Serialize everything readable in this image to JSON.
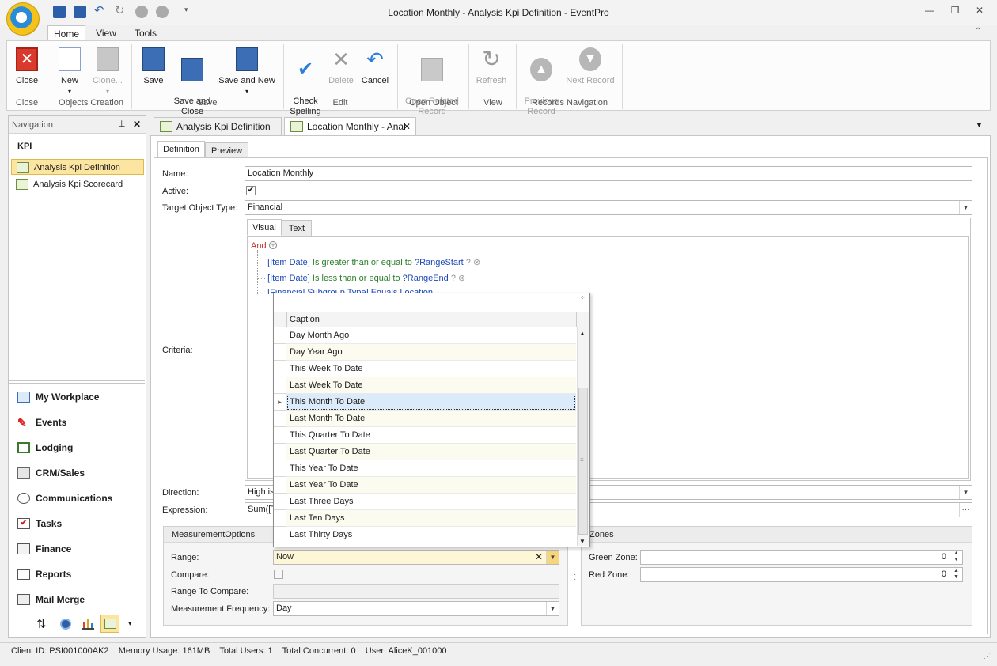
{
  "window": {
    "title": "Location Monthly - Analysis Kpi Definition - EventPro",
    "controls": [
      "minimize",
      "restore",
      "close"
    ]
  },
  "menu_tabs": [
    "Home",
    "View",
    "Tools"
  ],
  "ribbon": {
    "buttons": {
      "close": "Close",
      "new": "New",
      "clone": "Clone...",
      "save": "Save",
      "save_and_close": "Save and\nClose",
      "save_and_new": "Save and New",
      "check_spelling": "Check\nSpelling",
      "delete": "Delete",
      "cancel": "Cancel",
      "open_related": "Open Related\nRecord",
      "refresh": "Refresh",
      "previous_record": "Previous\nRecord",
      "next_record": "Next Record"
    },
    "groups": {
      "close": "Close",
      "objects_creation": "Objects Creation",
      "save": "Save",
      "edit": "Edit",
      "open_object": "Open Object",
      "view": "View",
      "records_navigation": "Records Navigation"
    }
  },
  "navigation": {
    "title": "Navigation",
    "section": "KPI",
    "items": [
      "Analysis Kpi Definition",
      "Analysis Kpi Scorecard"
    ],
    "modules": [
      "My Workplace",
      "Events",
      "Lodging",
      "CRM/Sales",
      "Communications",
      "Tasks",
      "Finance",
      "Reports",
      "Mail Merge"
    ]
  },
  "doc_tabs": [
    "Analysis Kpi Definition",
    "Location Monthly - Anal"
  ],
  "form": {
    "subtabs": [
      "Definition",
      "Preview"
    ],
    "name_label": "Name:",
    "name_value": "Location Monthly",
    "active_label": "Active:",
    "active_checked": true,
    "target_label": "Target Object Type:",
    "target_value": "Financial",
    "criteria_label": "Criteria:",
    "criteria_tabs": [
      "Visual",
      "Text"
    ],
    "criteria": {
      "root": "And",
      "c1_field": "[Item Date]",
      "c1_op": "Is greater than or equal to",
      "c1_val": "?RangeStart",
      "c2_field": "[Item Date]",
      "c2_op": "Is less than or equal to",
      "c2_val": "?RangeEnd",
      "c3_partial": "[Financial Subgroup Type] Equals Location"
    },
    "direction_label": "Direction:",
    "direction_value": "High is",
    "expression_label": "Expression:",
    "expression_value": "Sum([T",
    "measurement_group": "MeasurementOptions",
    "range_label": "Range:",
    "range_value": "Now",
    "compare_label": "Compare:",
    "range_to_compare_label": "Range To Compare:",
    "frequency_label": "Measurement Frequency:",
    "frequency_value": "Day",
    "zones_group": "Zones",
    "green_zone_label": "Green Zone:",
    "green_zone_value": "0",
    "red_zone_label": "Red Zone:",
    "red_zone_value": "0"
  },
  "dropdown": {
    "column": "Caption",
    "selected_index": 4,
    "items": [
      "Day Month Ago",
      "Day Year Ago",
      "This Week To Date",
      "Last Week To Date",
      "This Month To Date",
      "Last Month To Date",
      "This Quarter To Date",
      "Last Quarter To Date",
      "This Year To Date",
      "Last Year To Date",
      "Last Three Days",
      "Last Ten Days",
      "Last Thirty Days"
    ]
  },
  "status": {
    "client_id": "Client ID: PSI001000AK2",
    "memory": "Memory Usage: 161MB",
    "total_users": "Total Users: 1",
    "total_concurrent": "Total Concurrent: 0",
    "user": "User: AliceK_001000"
  },
  "colors": {
    "accent": "#f6d67a",
    "link_blue": "#1b47b8",
    "criteria_green": "#2b7d2b",
    "close_red": "#d93a2b"
  }
}
